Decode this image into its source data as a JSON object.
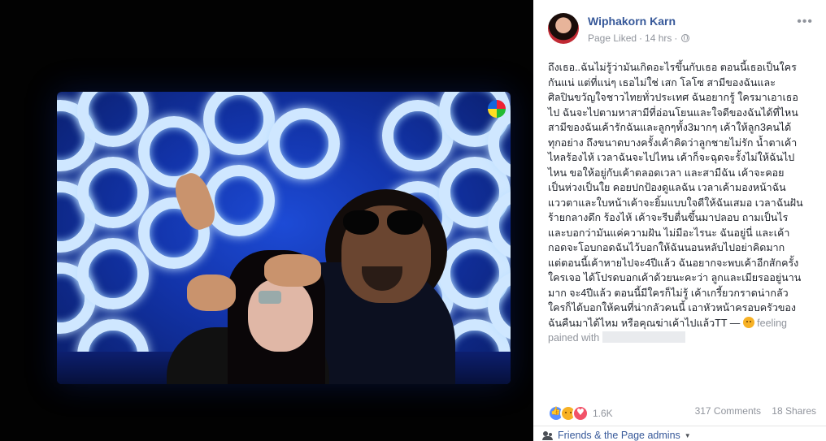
{
  "post": {
    "author": "Wiphakorn Karn",
    "page_status": "Page Liked",
    "separator": "·",
    "time": "14 hrs",
    "more_label": "•••",
    "text": "ถึงเธอ..ฉันไม่รู้ว่ามันเกิดอะไรขึ้นกับเธอ ตอนนี้เธอเป็นใคร\nกันแน่ แต่ที่แน่ๆ เธอไม่ใช่ เสก โลโซ สามีของฉันและ\nศิลปินขวัญใจชาวไทยทั่วประเทศ ฉันอยากรู้ ใครมาเอาเธอ\nไป ฉันจะไปตามหาสามีที่อ่อนโยนและใจดีของฉันได้ที่ไหน\nสามีของฉันเค้ารักฉันและลูกๆทั้ง3มากๆ เค้าให้ลูก3คนได้\nทุกอย่าง ถึงขนาดบางครั้งเค้าคิดว่าลูกชายไม่รัก น้ำตาเค้า\nไหลร้องไห้ เวลาฉันจะไปไหน เค้าก็จะฉุดจะรั้งไม่ให้ฉันไป\nไหน ขอให้อยู่กับเค้าตลอดเวลา และสามีฉัน เค้าจะคอย\nเป็นห่วงเป็นใย คอยปกป้องดูแลฉัน เวลาเค้ามองหน้าฉัน\nแววตาและใบหน้าเค้าจะยิ้มแบบใจดีให้ฉันเสมอ เวลาฉันฝัน\nร้ายกลางดึก ร้องไห้ เค้าจะรีบตื่นขึ้นมาปลอบ ถามเป็นไร\nและบอกว่ามันแค่ความฝัน ไม่มีอะไรนะ ฉันอยู่นี่ และเค้า\nกอดจะโอบกอดฉันไว้บอกให้ฉันนอนหลับไปอย่าคิดมาก\nแต่ตอนนี้เค้าหายไปจะ4ปีแล้ว ฉันอยากจะพบเค้าอีกสักครั้ง\nใครเจอ ได้โปรดบอกเค้าด้วยนะคะว่า ลูกและเมียรออยู่นาน\nมาก จะ4ปีแล้ว ตอนนี้มีใครก็ไม่รู้ เค้าเกรี้ยวกราดน่ากลัว\nใครก็ได้บอกให้คนที่น่ากลัวคนนี้ เอาหัวหน้าครอบครัวของ\nฉันคืนมาได้ไหม หรือคุณฆ่าเค้าไปแล้วTT — ",
    "feeling_label": "feeling",
    "feeling_value": "pained with",
    "reaction_count": "1.6K",
    "comments": "317 Comments",
    "shares": "18 Shares",
    "audience": "Friends & the Page admins",
    "audience_caret": "▼"
  },
  "icons": {
    "globe": "globe-icon",
    "feeling": "pained-emoji-icon",
    "reactions": [
      "like-reaction-icon",
      "sad-reaction-icon",
      "love-reaction-icon"
    ],
    "friends": "friends-icon"
  },
  "colors": {
    "link": "#365899",
    "muted": "#90949c",
    "text": "#1d2129"
  }
}
